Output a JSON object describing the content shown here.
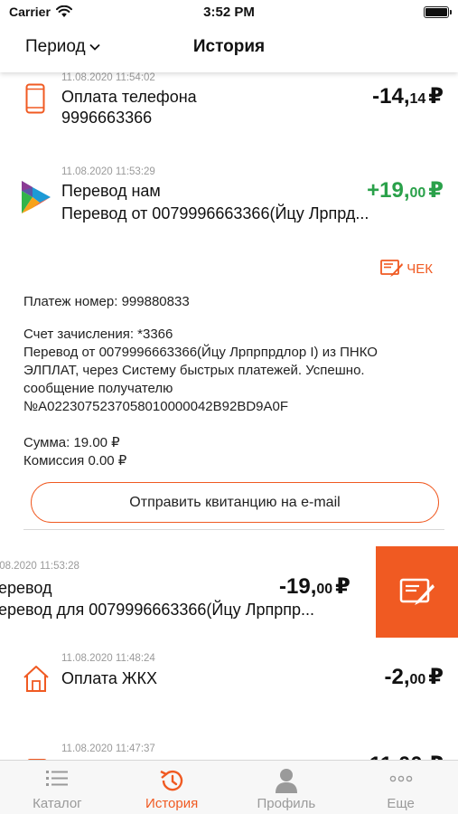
{
  "status_bar": {
    "carrier": "Carrier",
    "time": "3:52 PM"
  },
  "nav": {
    "period_label": "Период",
    "title": "История"
  },
  "colors": {
    "accent": "#f05a22",
    "positive": "#2aa14a",
    "date": "#9a9a9a"
  },
  "transactions": [
    {
      "date": "11.08.2020 11:54:02",
      "name": "Оплата телефона",
      "sub": "9996663366",
      "amount_main": "-14,",
      "amount_kop": "14",
      "currency": "₽",
      "icon": "phone-icon"
    },
    {
      "date": "11.08.2020 11:53:29",
      "name": "Перевод нам",
      "sub": "Перевод от 0079996663366(Йцу Лрпрд...",
      "amount_main": "+19,",
      "amount_kop": "00",
      "currency": "₽",
      "icon": "sbp-logo-icon"
    },
    {
      "date": ".08.2020 11:53:28",
      "name": "еревод",
      "sub": "еревод для 0079996663366(Йцу Лрпрпр...",
      "amount_main": "-19,",
      "amount_kop": "00",
      "currency": "₽",
      "icon": ""
    },
    {
      "date": "11.08.2020 11:48:24",
      "name": "Оплата ЖКХ",
      "sub": "",
      "amount_main": "-2,",
      "amount_kop": "00",
      "currency": "₽",
      "icon": "house-icon"
    },
    {
      "date": "11.08.2020 11:47:37",
      "name": "",
      "sub": "",
      "amount_main": "",
      "amount_kop": "",
      "currency": "",
      "icon": "document-icon"
    }
  ],
  "details": {
    "check_label": "ЧЕК",
    "payment_number": "Платеж номер: 999880833",
    "lines": [
      "Счет зачисления: *3366",
      "Перевод от 0079996663366(Йцу Лрпрпрдлор I) из ПНКО",
      "ЭЛПЛАТ, через Систему быстрых платежей. Успешно.",
      "сообщение получателю",
      "№A0223075237058010000042B92BD9A0F"
    ],
    "sum": "Сумма: 19.00 ₽",
    "commission": "Комиссия  0.00 ₽",
    "email_button": "Отправить квитанцию на e-mail"
  },
  "tabs": [
    {
      "label": "Каталог",
      "icon": "list-icon",
      "active": false
    },
    {
      "label": "История",
      "icon": "history-icon",
      "active": true
    },
    {
      "label": "Профиль",
      "icon": "profile-icon",
      "active": false
    },
    {
      "label": "Еще",
      "icon": "more-icon",
      "active": false
    }
  ]
}
